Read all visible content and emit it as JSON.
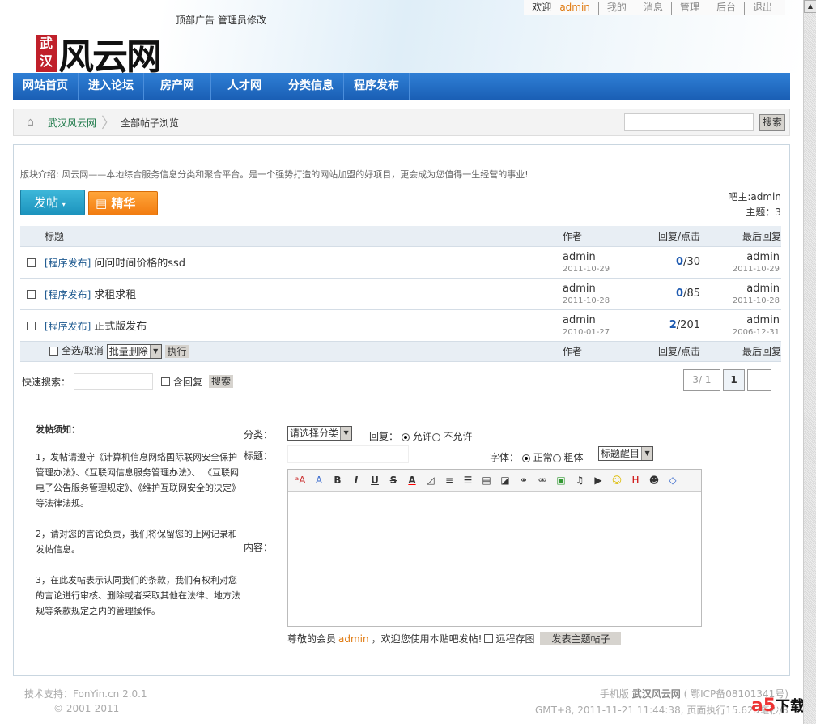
{
  "top": {
    "welcome": "欢迎",
    "user": "admin",
    "links": [
      "我的",
      "消息",
      "管理",
      "后台",
      "退出"
    ]
  },
  "header": {
    "ad": "顶部广告 管理员修改",
    "logo_small": "武汉",
    "logo_main": "风云网"
  },
  "nav": [
    "网站首页",
    "进入论坛",
    "房产网",
    "人才网",
    "分类信息",
    "程序发布"
  ],
  "breadcrumb": {
    "home": "武汉风云网",
    "current": "全部帖子浏览",
    "search_btn": "搜索"
  },
  "forum": {
    "intro": "版块介绍: 风云网——本地综合服务信息分类和聚合平台。是一个强势打造的网站加盟的好项目，更会成为您值得一生经营的事业!",
    "post_btn": "发帖",
    "essence_btn": "精华",
    "owner": "吧主:admin",
    "topics": "主题：3"
  },
  "table": {
    "headers": [
      "标题",
      "作者",
      "回复/点击",
      "最后回复"
    ],
    "rows": [
      {
        "cat": "[程序发布]",
        "title": "问问时间价格的ssd",
        "author": "admin",
        "date": "2011-10-29",
        "replies": "0",
        "clicks": "/30",
        "last_user": "admin",
        "last_date": "2011-10-29"
      },
      {
        "cat": "[程序发布]",
        "title": "求租求租",
        "author": "admin",
        "date": "2011-10-28",
        "replies": "0",
        "clicks": "/85",
        "last_user": "admin",
        "last_date": "2011-10-28"
      },
      {
        "cat": "[程序发布]",
        "title": "正式版发布",
        "author": "admin",
        "date": "2010-01-27",
        "replies": "2",
        "clicks": "/201",
        "last_user": "admin",
        "last_date": "2006-12-31"
      }
    ],
    "select_all": "全选/取消",
    "batch": "批量删除",
    "exec": "执行"
  },
  "quick": {
    "label": "快速搜索：",
    "include_reply": "含回复",
    "btn": "搜索"
  },
  "pager": {
    "info": "3/ 1",
    "current": "1"
  },
  "notice": {
    "title": "发帖须知：",
    "items": [
      "1，发帖请遵守《计算机信息网络国际联网安全保护管理办法》、《互联网信息服务管理办法》、 《互联网电子公告服务管理规定》、《维护互联网安全的决定》等法律法规。",
      "2，请对您的言论负责，我们将保留您的上网记录和发帖信息。",
      "3，在此发帖表示认同我们的条款，我们有权利对您的言论进行审核、删除或者采取其他在法律、地方法规等条款规定之内的管理操作。"
    ]
  },
  "form": {
    "cat_label": "分类：",
    "cat_value": "请选择分类",
    "reply_label": "回复：",
    "allow": "允许",
    "disallow": "不允许",
    "title_label": "标题：",
    "font_label": "字体：",
    "normal": "正常",
    "bold": "粗体",
    "highlight": "标题醒目",
    "content_label": "内容：",
    "greet_pre": "尊敬的会员",
    "greet_user": "admin",
    "greet_post": "，欢迎您使用本贴吧发帖!",
    "remote": "远程存图",
    "submit": "发表主题帖子"
  },
  "footer": {
    "support": "技术支持：FonYin.cn 2.0.1",
    "copyright": "© 2001-2011",
    "mobile": "手机版",
    "site": "武汉风云网",
    "icp": "( 鄂ICP备08101341号)",
    "time": "GMT+8, 2011-11-21 11:44:38, 页面执行15.625毫秒/3"
  },
  "watermark": {
    "text": "a5下载"
  }
}
